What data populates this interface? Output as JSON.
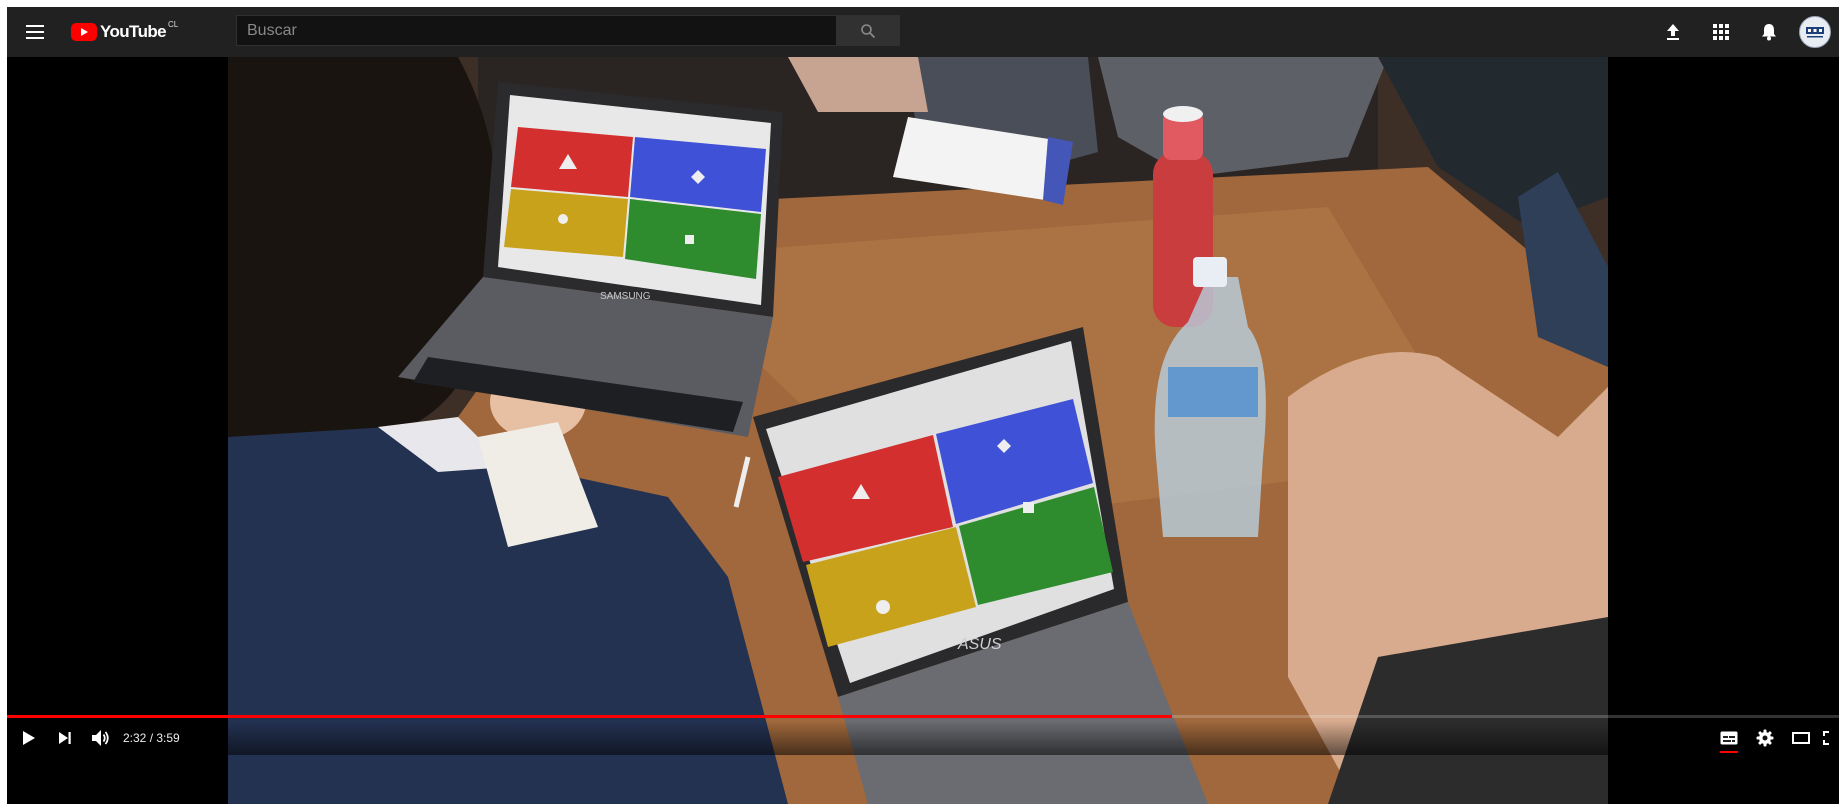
{
  "header": {
    "logo_text": "YouTube",
    "country_code": "CL",
    "search_placeholder": "Buscar",
    "icons": [
      "menu-icon",
      "search-icon",
      "upload-icon",
      "apps-icon",
      "notifications-icon",
      "avatar"
    ]
  },
  "player": {
    "current_time": "2:32",
    "duration": "3:59",
    "time_display": "2:32 / 3:59",
    "progress_fraction": 0.636,
    "controls": [
      "play-icon",
      "next-icon",
      "volume-icon",
      "subtitles-icon",
      "settings-icon",
      "theater-icon",
      "fullscreen-icon"
    ],
    "video_text": {
      "laptop_brand_left": "SAMSUNG",
      "laptop_brand_right": "ASUS"
    }
  },
  "colors": {
    "topbar": "#212121",
    "brand_red": "#ff0000",
    "answer_red": "#d32f2f",
    "answer_blue": "#3f51d6",
    "answer_yellow": "#c9a21b",
    "answer_green": "#2e8b2e"
  }
}
